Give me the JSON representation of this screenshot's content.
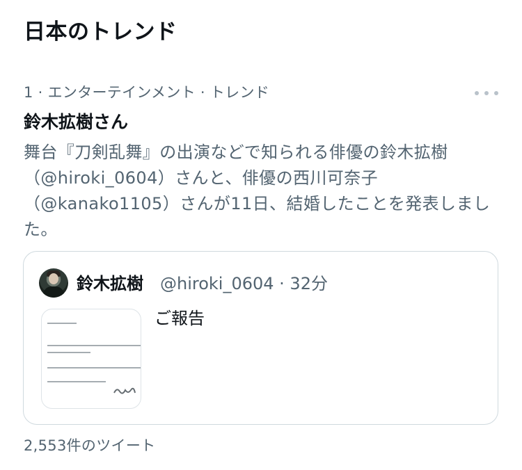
{
  "header": {
    "title": "日本のトレンド"
  },
  "trend": {
    "meta": "1 · エンターテインメント · トレンド",
    "name": "鈴木拡樹さん",
    "description": "舞台『刀剣乱舞』の出演などで知られる俳優の鈴木拡樹（@hiroki_0604）さんと、俳優の西川可奈子（@kanako1105）さんが11日、結婚したことを発表しました。",
    "more_icon": "more-horizontal-icon",
    "tweet_count": "2,553件のツイート"
  },
  "tweet": {
    "author_name": "鈴木拡樹",
    "author_handle": "@hiroki_0604 · 32分",
    "text": "ご報告",
    "avatar_icon": "user-avatar",
    "image_icon": "document-image-icon"
  },
  "colors": {
    "text_primary": "#0f1419",
    "text_secondary": "#536471",
    "border": "#cfd9de"
  }
}
